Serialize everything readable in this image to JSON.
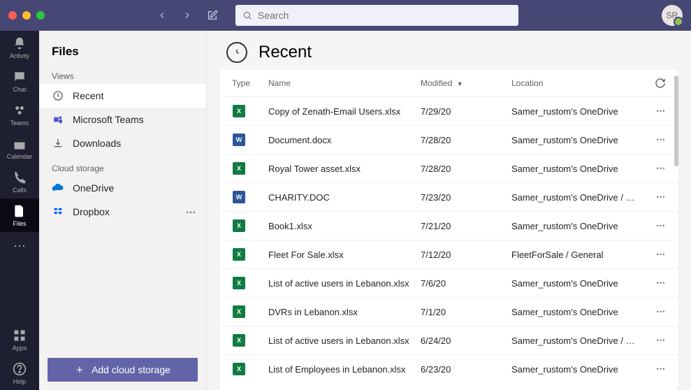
{
  "titlebar": {
    "search_placeholder": "Search"
  },
  "avatar": {
    "initials": "SR"
  },
  "rail": [
    {
      "key": "activity",
      "label": "Activity"
    },
    {
      "key": "chat",
      "label": "Chat"
    },
    {
      "key": "teams",
      "label": "Teams"
    },
    {
      "key": "calendar",
      "label": "Calendar"
    },
    {
      "key": "calls",
      "label": "Calls"
    },
    {
      "key": "files",
      "label": "Files",
      "active": true
    }
  ],
  "rail_bottom": [
    {
      "key": "apps",
      "label": "Apps"
    },
    {
      "key": "help",
      "label": "Help"
    }
  ],
  "sidebar": {
    "title": "Files",
    "section_views": "Views",
    "items_views": [
      {
        "key": "recent",
        "label": "Recent",
        "selected": true
      },
      {
        "key": "msteams",
        "label": "Microsoft Teams"
      },
      {
        "key": "downloads",
        "label": "Downloads"
      }
    ],
    "section_cloud": "Cloud storage",
    "items_cloud": [
      {
        "key": "onedrive",
        "label": "OneDrive"
      },
      {
        "key": "dropbox",
        "label": "Dropbox",
        "show_dots": true
      }
    ],
    "add_cloud_label": "Add cloud storage"
  },
  "main": {
    "heading": "Recent",
    "columns": {
      "type": "Type",
      "name": "Name",
      "modified": "Modified",
      "location": "Location"
    },
    "rows": [
      {
        "ftype": "xlsx",
        "name": "Copy of Zenath-Email Users.xlsx",
        "modified": "7/29/20",
        "location": "Samer_rustom's OneDrive"
      },
      {
        "ftype": "docx",
        "name": "Document.docx",
        "modified": "7/28/20",
        "location": "Samer_rustom's OneDrive"
      },
      {
        "ftype": "xlsx",
        "name": "Royal Tower asset.xlsx",
        "modified": "7/28/20",
        "location": "Samer_rustom's OneDrive"
      },
      {
        "ftype": "docx",
        "name": "CHARITY.DOC",
        "modified": "7/23/20",
        "location": "Samer_rustom's OneDrive / …"
      },
      {
        "ftype": "xlsx",
        "name": "Book1.xlsx",
        "modified": "7/21/20",
        "location": "Samer_rustom's OneDrive"
      },
      {
        "ftype": "xlsx",
        "name": "Fleet For Sale.xlsx",
        "modified": "7/12/20",
        "location": "FleetForSale / General"
      },
      {
        "ftype": "xlsx",
        "name": "List of active users in Lebanon.xlsx",
        "modified": "7/6/20",
        "location": "Samer_rustom's OneDrive"
      },
      {
        "ftype": "xlsx",
        "name": "DVRs in Lebanon.xlsx",
        "modified": "7/1/20",
        "location": "Samer_rustom's OneDrive"
      },
      {
        "ftype": "xlsx",
        "name": "List of active users in Lebanon.xlsx",
        "modified": "6/24/20",
        "location": "Samer_rustom's OneDrive / …"
      },
      {
        "ftype": "xlsx",
        "name": "List of Employees in Lebanon.xlsx",
        "modified": "6/23/20",
        "location": "Samer_rustom's OneDrive"
      }
    ]
  }
}
